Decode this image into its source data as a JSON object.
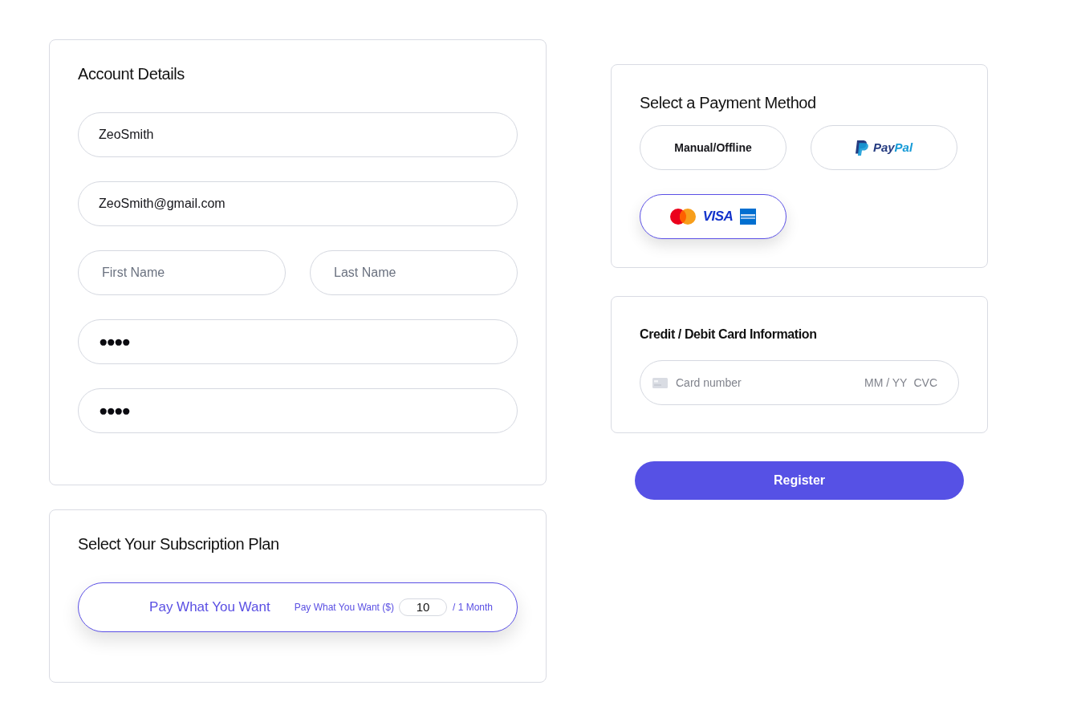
{
  "account_details": {
    "title": "Account Details",
    "username": {
      "value": "ZeoSmith"
    },
    "email": {
      "value": "ZeoSmith@gmail.com"
    },
    "first_name": {
      "placeholder": "First Name"
    },
    "last_name": {
      "placeholder": "Last Name"
    },
    "password": {
      "value": "●●●●"
    },
    "confirm_password": {
      "value": "●●●●"
    }
  },
  "subscription": {
    "title": "Select Your Subscription Plan",
    "plans": [
      {
        "name": "Pay What You Want",
        "selected": true,
        "amount_label": "Pay What You Want ($)",
        "amount": "10",
        "period": "/ 1 Month"
      }
    ]
  },
  "payment": {
    "title": "Select a Payment Method",
    "methods": [
      {
        "kind": "text",
        "label": "Manual/Offline",
        "selected": false
      },
      {
        "kind": "paypal",
        "logo_text": [
          "Pay",
          "Pal"
        ],
        "selected": false
      },
      {
        "kind": "cards",
        "logo_text": "VISA",
        "selected": true
      }
    ]
  },
  "card_info": {
    "title": "Credit / Debit Card Information",
    "card_number": {
      "placeholder": "Card number"
    },
    "expiry": {
      "placeholder": "MM / YY"
    },
    "cvc": {
      "placeholder": "CVC"
    }
  },
  "register_button": {
    "label": "Register"
  }
}
